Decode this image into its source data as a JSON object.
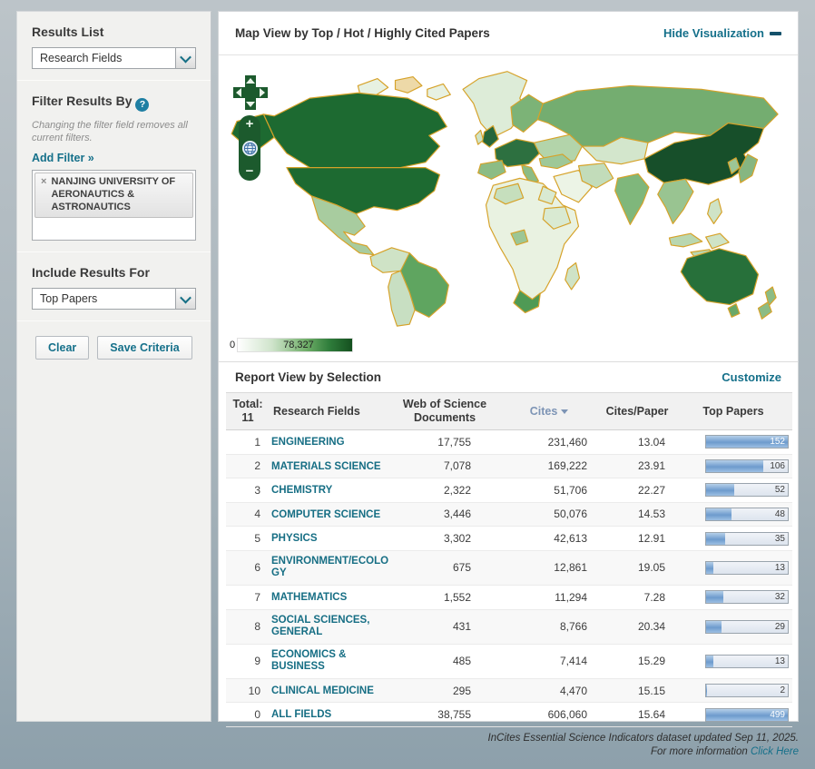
{
  "sidebar": {
    "results_list_label": "Results List",
    "results_list_value": "Research Fields",
    "filter_by_label": "Filter Results By",
    "filter_note": "Changing the filter field removes all current filters.",
    "add_filter_label": "Add Filter »",
    "filter_tag_remove": "×",
    "filter_tag": "NANJING UNIVERSITY OF AERONAUTICS & ASTRONAUTICS",
    "include_label": "Include Results For",
    "include_value": "Top Papers",
    "clear_label": "Clear",
    "save_label": "Save Criteria",
    "help_icon": "?"
  },
  "map": {
    "title": "Map View by Top / Hot / Highly Cited Papers",
    "hide_link": "Hide Visualization",
    "legend_min": "0",
    "legend_max": "78,327",
    "legend_colors": {
      "low": "#ffffff",
      "high": "#14501f"
    }
  },
  "report": {
    "title": "Report View by Selection",
    "customize_link": "Customize",
    "total_label": "Total:",
    "total_value": "11",
    "columns": {
      "field": "Research Fields",
      "docs": "Web of Science Documents",
      "cites": "Cites",
      "cites_per_paper": "Cites/Paper",
      "top_papers": "Top Papers"
    },
    "sorted_column": "Cites",
    "bar_max": 152,
    "accent_colors": {
      "link_teal": "#15708a",
      "sorted_header_blue": "#7d94b5",
      "bar_blue": "#6d9bcd"
    },
    "rows": [
      {
        "rank": "1",
        "field": "ENGINEERING",
        "docs": "17,755",
        "cites": "231,460",
        "cpp": "13.04",
        "top_papers": 152
      },
      {
        "rank": "2",
        "field": "MATERIALS SCIENCE",
        "docs": "7,078",
        "cites": "169,222",
        "cpp": "23.91",
        "top_papers": 106
      },
      {
        "rank": "3",
        "field": "CHEMISTRY",
        "docs": "2,322",
        "cites": "51,706",
        "cpp": "22.27",
        "top_papers": 52
      },
      {
        "rank": "4",
        "field": "COMPUTER SCIENCE",
        "docs": "3,446",
        "cites": "50,076",
        "cpp": "14.53",
        "top_papers": 48
      },
      {
        "rank": "5",
        "field": "PHYSICS",
        "docs": "3,302",
        "cites": "42,613",
        "cpp": "12.91",
        "top_papers": 35
      },
      {
        "rank": "6",
        "field": "ENVIRONMENT/ECOLOGY",
        "docs": "675",
        "cites": "12,861",
        "cpp": "19.05",
        "top_papers": 13
      },
      {
        "rank": "7",
        "field": "MATHEMATICS",
        "docs": "1,552",
        "cites": "11,294",
        "cpp": "7.28",
        "top_papers": 32
      },
      {
        "rank": "8",
        "field": "SOCIAL SCIENCES, GENERAL",
        "docs": "431",
        "cites": "8,766",
        "cpp": "20.34",
        "top_papers": 29
      },
      {
        "rank": "9",
        "field": "ECONOMICS & BUSINESS",
        "docs": "485",
        "cites": "7,414",
        "cpp": "15.29",
        "top_papers": 13
      },
      {
        "rank": "10",
        "field": "CLINICAL MEDICINE",
        "docs": "295",
        "cites": "4,470",
        "cpp": "15.15",
        "top_papers": 2
      },
      {
        "rank": "0",
        "field": "ALL FIELDS",
        "docs": "38,755",
        "cites": "606,060",
        "cpp": "15.64",
        "top_papers": 499
      }
    ]
  },
  "footer": {
    "line1": "InCites Essential Science Indicators dataset updated Sep 11, 2025.",
    "line2": "For more information",
    "link": "Click Here"
  }
}
